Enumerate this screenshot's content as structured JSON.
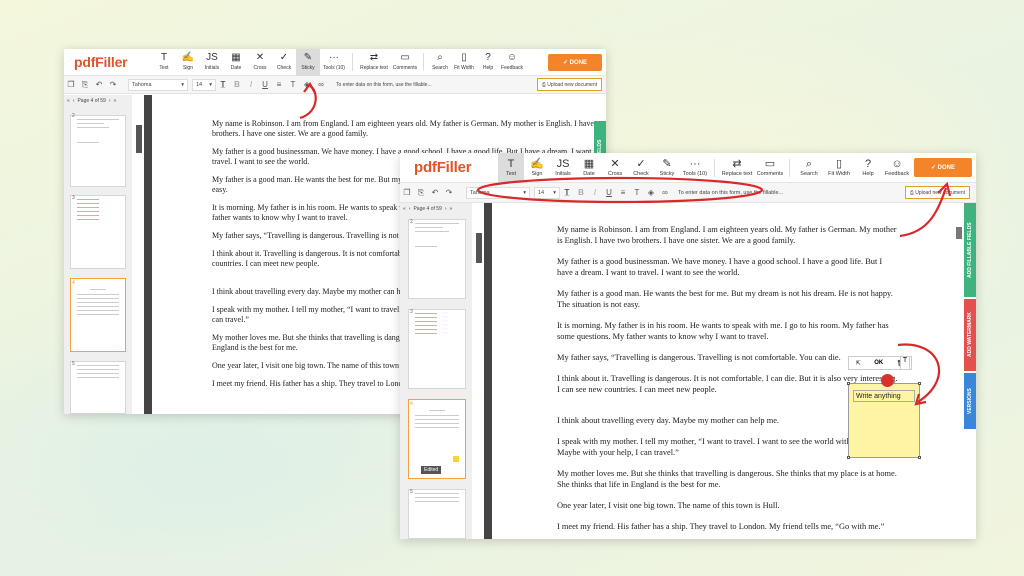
{
  "logo": "pdfFiller",
  "tools": [
    {
      "label": "Text",
      "icon": "text-icon"
    },
    {
      "label": "Sign",
      "icon": "sign-icon"
    },
    {
      "label": "Initials",
      "icon": "initials-icon"
    },
    {
      "label": "Date",
      "icon": "date-icon"
    },
    {
      "label": "Cross",
      "icon": "cross-icon"
    },
    {
      "label": "Check",
      "icon": "check-icon"
    },
    {
      "label": "Sticky",
      "icon": "sticky-icon"
    },
    {
      "label": "Tools (10)",
      "icon": "more-icon"
    }
  ],
  "tools_right": [
    {
      "label": "Replace text",
      "icon": "replace-icon"
    },
    {
      "label": "Comments",
      "icon": "comments-icon"
    }
  ],
  "tools_far": [
    {
      "label": "Search",
      "icon": "search-icon"
    },
    {
      "label": "Fit Width",
      "icon": "fit-width-icon"
    },
    {
      "label": "Help",
      "icon": "help-icon"
    },
    {
      "label": "Feedback",
      "icon": "feedback-icon"
    }
  ],
  "done": "DONE",
  "format": {
    "font": "Tahoma",
    "size": "14",
    "hint": "To enter data on this form, use the fillable...",
    "upload": "Upload new document"
  },
  "page_nav": "Page 4 of 59",
  "thumb_numbers": [
    "2",
    "3",
    "4",
    "5"
  ],
  "edited_badge": "Edited",
  "right_tabs": [
    "FILLABLE FIELDS",
    "ADD FILLABLE FIELDS",
    "ADD WATERMARK",
    "VERSIONS"
  ],
  "sticky": {
    "text": "Write anything",
    "ok": "OK"
  },
  "doc": [
    "My name is Robinson. I am from England. I am eighteen years old. My father is German. My mother is English. I have two brothers. I have one sister. We are a good family.",
    "My father is a good businessman. We have money. I have a good school. I have a good life. But I have a dream. I want to travel. I want to see the world.",
    "My father is a good man. He wants the best for me. But my dream is not his dream. He is not happy. The situation is not easy.",
    "It is morning. My father is in his room. He wants to speak with me. I go to his room. My father has some questions. My father wants to know why I want to travel.",
    "My father says, “Travelling is dangerous. Travelling is not comfortable. You can die.",
    "I think about it. Travelling is dangerous. It is not comfortable. I can die. But it is also very interesting. I can see new countries. I can meet new people.",
    "I think about travelling every day. Maybe my mother can help me.",
    "I speak with my mother. I tell my mother, “I want to travel. I want to see the world with my father. Maybe with your help, I can travel.”",
    "My mother loves me. But she thinks that travelling is dangerous. She thinks that my place is at home. She thinks that life in England is the best for me.",
    "One year later, I visit one big town. The name of this town is Hull.",
    "I meet my friend. His father has a ship. They travel to London. My friend tells me, “Go with me.”"
  ]
}
